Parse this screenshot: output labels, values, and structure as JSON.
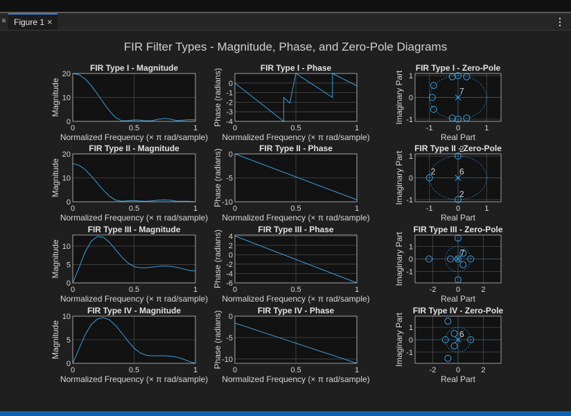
{
  "window": {
    "tab_label": "Figure 1",
    "close_glyph": "×",
    "menu_glyph": "⋮",
    "grip_glyph": "≡"
  },
  "figure": {
    "suptitle": "FIR Filter Types - Magnitude, Phase, and Zero-Pole Diagrams"
  },
  "colors": {
    "line": "#3b9fe0",
    "axes_bg": "#121212",
    "axes_edge": "#bfbfbf",
    "grid": "#4a4a4a",
    "text": "#d7d7d7",
    "title": "#e2e2e2",
    "accent_tab": "#3b83d6",
    "status_bar": "#0e62b1"
  },
  "chart_data": [
    {
      "type": "line",
      "title": "FIR Type I - Magnitude",
      "xlabel": "Normalized Frequency (× π rad/sample)",
      "ylabel": "Magnitude",
      "xlim": [
        0,
        1
      ],
      "ylim": [
        0,
        20
      ],
      "xticks": [
        "0",
        "0.5",
        "1"
      ],
      "yticks": [
        "0",
        "10",
        "20"
      ],
      "x": [
        0,
        0.05,
        0.1,
        0.15,
        0.2,
        0.25,
        0.3,
        0.35,
        0.4,
        0.45,
        0.5,
        0.55,
        0.6,
        0.65,
        0.7,
        0.75,
        0.8,
        0.85,
        0.9,
        0.95,
        1
      ],
      "series": [
        {
          "values": [
            20,
            19.5,
            17.8,
            15,
            11.5,
            7.8,
            4.3,
            1.6,
            0.2,
            0.3,
            0.6,
            0.5,
            0.2,
            0.3,
            0.9,
            1.2,
            0.9,
            0.3,
            0.5,
            0.7,
            0.6
          ]
        }
      ]
    },
    {
      "type": "line",
      "title": "FIR Type I - Phase",
      "xlabel": "Normalized Frequency (× π rad/sample)",
      "ylabel": "Phase (radians)",
      "xlim": [
        0,
        1
      ],
      "ylim": [
        -4,
        1
      ],
      "xticks": [
        "0",
        "0.5",
        "1"
      ],
      "yticks": [
        "-4",
        "-3",
        "-2",
        "-1",
        "0"
      ],
      "x": [
        0,
        0.4,
        0.4,
        0.45,
        0.5,
        0.5,
        0.8,
        0.8,
        1
      ],
      "series": [
        {
          "values": [
            0,
            -4,
            -1.5,
            -2.1,
            1,
            1,
            -1.5,
            1,
            -0.3
          ]
        }
      ]
    },
    {
      "type": "scatter",
      "title": "FIR Type I - Zero-Pole",
      "xlabel": "Real Part",
      "ylabel": "Imaginary Part",
      "xlim": [
        -1.5,
        1.5
      ],
      "ylim": [
        -1.1,
        1.1
      ],
      "xticks": [
        "-1",
        "0",
        "1"
      ],
      "yticks": [
        "-1",
        "0",
        "1"
      ],
      "zeros": {
        "x": [
          -0.2,
          0.3,
          -0.9,
          -0.2,
          0.3,
          0,
          0
        ],
        "y": [
          0.95,
          0.95,
          0,
          -0.95,
          -0.95,
          1,
          -1
        ]
      },
      "extra_zeros": {
        "x": [
          -0.85,
          -0.85
        ],
        "y": [
          0.55,
          -0.55
        ]
      },
      "poles": {
        "x": [
          0
        ],
        "y": [
          0
        ]
      },
      "annotations": [
        "7"
      ]
    },
    {
      "type": "line",
      "title": "FIR Type II - Magnitude",
      "xlabel": "Normalized Frequency (× π rad/sample)",
      "ylabel": "Magnitude",
      "xlim": [
        0,
        1
      ],
      "ylim": [
        0,
        20
      ],
      "xticks": [
        "0",
        "0.5",
        "1"
      ],
      "yticks": [
        "0",
        "10",
        "20"
      ],
      "x": [
        0,
        0.05,
        0.1,
        0.15,
        0.2,
        0.25,
        0.3,
        0.35,
        0.4,
        0.45,
        0.5,
        0.55,
        0.6,
        0.65,
        0.7,
        0.75,
        0.8,
        0.85,
        0.9,
        0.95,
        1
      ],
      "series": [
        {
          "values": [
            16,
            15.3,
            13.5,
            10.8,
            7.8,
            4.8,
            2.3,
            0.7,
            0.2,
            0.4,
            0.5,
            0.3,
            0.2,
            0.4,
            0.7,
            0.8,
            0.6,
            0.2,
            0.2,
            0.2,
            0
          ]
        }
      ]
    },
    {
      "type": "line",
      "title": "FIR Type II - Phase",
      "xlabel": "Normalized Frequency (× π rad/sample)",
      "ylabel": "Phase (radians)",
      "xlim": [
        0,
        1
      ],
      "ylim": [
        -10,
        0
      ],
      "xticks": [
        "0",
        "0.5",
        "1"
      ],
      "yticks": [
        "-10",
        "-5",
        "0"
      ],
      "x": [
        0,
        1
      ],
      "series": [
        {
          "values": [
            0,
            -9.6
          ]
        }
      ]
    },
    {
      "type": "scatter",
      "title": "FIR Type II - Zero-Pole",
      "xlabel": "Real Part",
      "ylabel": "Imaginary Part",
      "xlim": [
        -1.5,
        1.5
      ],
      "ylim": [
        -1.1,
        1.1
      ],
      "xticks": [
        "-1",
        "0",
        "1"
      ],
      "yticks": [
        "-1",
        "0",
        "1"
      ],
      "zeros": {
        "x": [
          -1,
          0,
          0
        ],
        "y": [
          0,
          1,
          -1
        ]
      },
      "poles": {
        "x": [
          0
        ],
        "y": [
          0
        ]
      },
      "annotations": [
        "2",
        "2",
        "6",
        "2"
      ]
    },
    {
      "type": "line",
      "title": "FIR Type III - Magnitude",
      "xlabel": "Normalized Frequency (× π rad/sample)",
      "ylabel": "Magnitude",
      "xlim": [
        0,
        1
      ],
      "ylim": [
        0,
        13
      ],
      "xticks": [
        "0",
        "0.5",
        "1"
      ],
      "yticks": [
        "0",
        "5",
        "10"
      ],
      "x": [
        0,
        0.05,
        0.1,
        0.15,
        0.2,
        0.25,
        0.3,
        0.35,
        0.4,
        0.45,
        0.5,
        0.55,
        0.6,
        0.65,
        0.7,
        0.75,
        0.8,
        0.85,
        0.9,
        0.95,
        1
      ],
      "series": [
        {
          "values": [
            0,
            4,
            8.3,
            11.3,
            12.6,
            12.4,
            11,
            9,
            7,
            5.4,
            4.4,
            4.1,
            4.1,
            4.3,
            4.5,
            4.6,
            4.5,
            4.2,
            3.8,
            3.4,
            3.2
          ]
        }
      ]
    },
    {
      "type": "line",
      "title": "FIR Type III - Phase",
      "xlabel": "Normalized Frequency (× π rad/sample)",
      "ylabel": "Phase (radians)",
      "xlim": [
        0,
        1
      ],
      "ylim": [
        -6,
        4.2
      ],
      "xticks": [
        "0",
        "0.5",
        "1"
      ],
      "yticks": [
        "-6",
        "-4",
        "-2",
        "0",
        "2",
        "4"
      ],
      "x": [
        0,
        1
      ],
      "series": [
        {
          "values": [
            4,
            -6
          ]
        }
      ]
    },
    {
      "type": "scatter",
      "title": "FIR Type III - Zero-Pole",
      "xlabel": "Real Part",
      "ylabel": "Imaginary Part",
      "xlim": [
        -3.4,
        3.4
      ],
      "ylim": [
        -1.9,
        1.9
      ],
      "xticks": [
        "-2",
        "0",
        "2"
      ],
      "yticks": [
        "-1",
        "0",
        "1"
      ],
      "zeros": {
        "x": [
          -2.3,
          -0.6,
          0,
          1,
          0,
          0.4,
          0.4,
          0
        ],
        "y": [
          0,
          0,
          0,
          0,
          1.65,
          0.45,
          -0.45,
          -1.65
        ]
      },
      "poles": {
        "x": [
          0
        ],
        "y": [
          0
        ]
      },
      "annotations": [
        "7"
      ]
    },
    {
      "type": "line",
      "title": "FIR Type IV - Magnitude",
      "xlabel": "Normalized Frequency (× π rad/sample)",
      "ylabel": "Magnitude",
      "xlim": [
        0,
        1
      ],
      "ylim": [
        0,
        10
      ],
      "xticks": [
        "0",
        "0.5",
        "1"
      ],
      "yticks": [
        "0",
        "5",
        "10"
      ],
      "x": [
        0,
        0.05,
        0.1,
        0.15,
        0.2,
        0.25,
        0.3,
        0.35,
        0.4,
        0.45,
        0.5,
        0.55,
        0.6,
        0.65,
        0.7,
        0.75,
        0.8,
        0.85,
        0.9,
        0.95,
        1
      ],
      "series": [
        {
          "values": [
            0,
            3,
            6,
            8.2,
            9.4,
            9.7,
            9.2,
            8,
            6.4,
            4.7,
            3.2,
            2.2,
            1.7,
            1.6,
            1.6,
            1.6,
            1.5,
            1.3,
            0.9,
            0.4,
            0
          ]
        }
      ]
    },
    {
      "type": "line",
      "title": "FIR Type IV - Phase",
      "xlabel": "Normalized Frequency (× π rad/sample)",
      "ylabel": "Phase (radians)",
      "xlim": [
        0,
        1
      ],
      "ylim": [
        -11,
        0
      ],
      "xticks": [
        "0",
        "0.5",
        "1"
      ],
      "yticks": [
        "-10",
        "-5",
        "0"
      ],
      "x": [
        0,
        1
      ],
      "series": [
        {
          "values": [
            -1.6,
            -11
          ]
        }
      ]
    },
    {
      "type": "scatter",
      "title": "FIR Type IV - Zero-Pole",
      "xlabel": "Real Part",
      "ylabel": "Imaginary Part",
      "xlim": [
        -3.4,
        3.4
      ],
      "ylim": [
        -1.9,
        1.9
      ],
      "xticks": [
        "-2",
        "0",
        "2"
      ],
      "yticks": [
        "-1",
        "0",
        "1"
      ],
      "zeros": {
        "x": [
          -0.8,
          -1,
          -0.3,
          1,
          -0.8,
          -0.3
        ],
        "y": [
          1.5,
          0,
          0.5,
          0,
          -1.5,
          -0.5
        ]
      },
      "poles": {
        "x": [
          0
        ],
        "y": [
          0
        ]
      },
      "annotations": [
        "6"
      ]
    }
  ]
}
